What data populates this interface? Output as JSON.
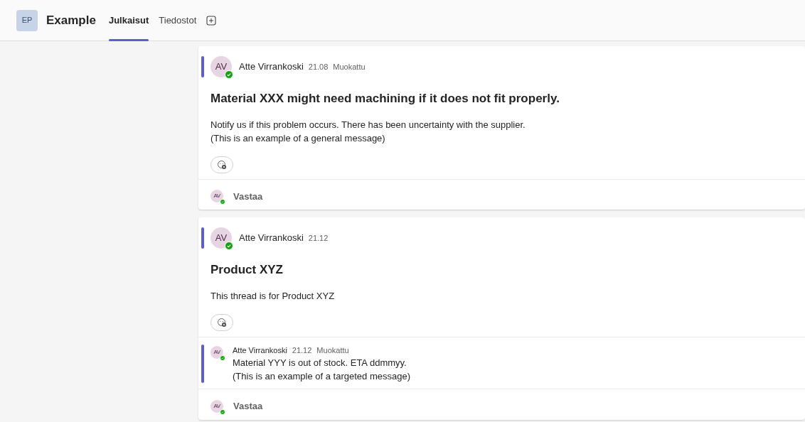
{
  "team": {
    "initials": "EP",
    "name": "Example"
  },
  "tabs": [
    {
      "label": "Julkaisut",
      "selected": true
    },
    {
      "label": "Tiedostot",
      "selected": false
    }
  ],
  "posts": [
    {
      "unread": true,
      "avatar": {
        "initials": "AV",
        "online": true
      },
      "author": "Atte Virrankoski",
      "time": "21.08",
      "edited": "Muokattu",
      "subject": "Material XXX might need machining if it does not fit properly.",
      "body": [
        "Notify us if this problem occurs. There has been uncertainty with the supplier.",
        "(This is an example of a general message)"
      ],
      "reply_box": {
        "avatar": {
          "initials": "AV",
          "online": true
        },
        "label": "Vastaa"
      }
    },
    {
      "unread": true,
      "avatar": {
        "initials": "AV",
        "online": true
      },
      "author": "Atte Virrankoski",
      "time": "21.12",
      "subject": "Product XYZ",
      "body": [
        "This thread is for Product XYZ"
      ],
      "replies": [
        {
          "unread": true,
          "avatar": {
            "initials": "AV",
            "online": true
          },
          "author": "Atte Virrankoski",
          "time": "21.12",
          "edited": "Muokattu",
          "body": [
            "Material YYY is out of stock. ETA ddmmyy.",
            "(This is an example of a targeted message)"
          ]
        }
      ],
      "reply_box": {
        "avatar": {
          "initials": "AV",
          "online": true
        },
        "label": "Vastaa"
      }
    }
  ]
}
